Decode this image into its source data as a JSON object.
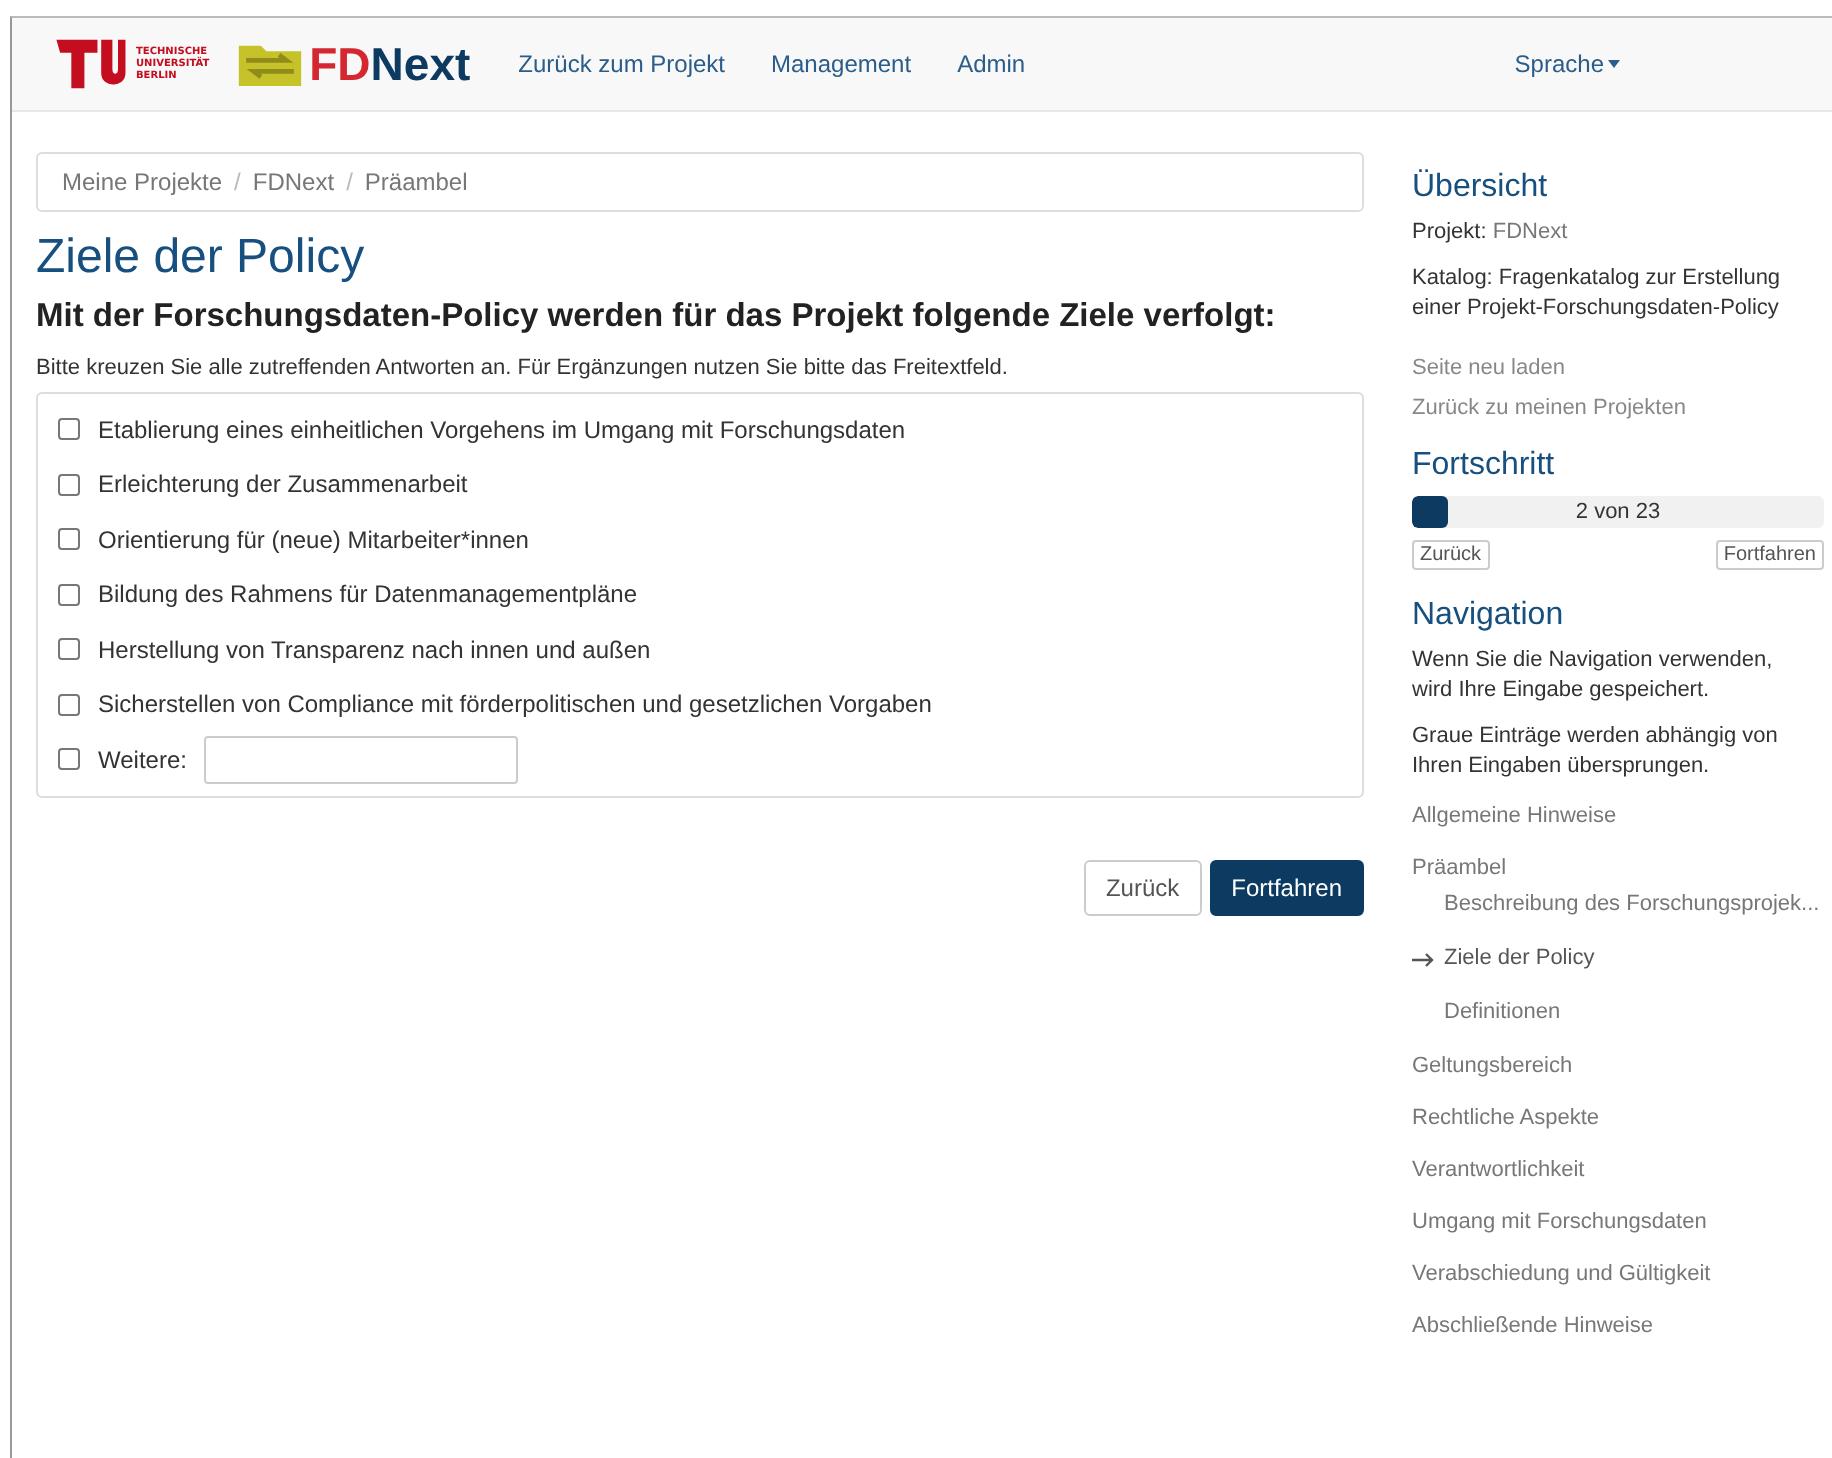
{
  "navbar": {
    "logo_lines": [
      "TECHNISCHE",
      "UNIVERSITÄT",
      "BERLIN"
    ],
    "brand": {
      "part1": "FD",
      "part2": "Next"
    },
    "links": [
      "Zurück zum Projekt",
      "Management",
      "Admin"
    ],
    "language": "Sprache"
  },
  "breadcrumb": {
    "separator": "/",
    "items": [
      "Meine Projekte",
      "FDNext",
      "Präambel"
    ]
  },
  "page_title": "Ziele der Policy",
  "question": "Mit der Forschungsdaten-Policy werden für das Projekt folgende Ziele verfolgt:",
  "help": "Bitte kreuzen Sie alle zutreffenden Antworten an. Für Ergänzungen nutzen Sie bitte das Freitextfeld.",
  "options": [
    {
      "label": "Etablierung eines einheitlichen Vorgehens im Umgang mit Forschungsdaten",
      "checked": false,
      "kind": "plain"
    },
    {
      "label": "Erleichterung der Zusammenarbeit",
      "checked": false,
      "kind": "plain"
    },
    {
      "label": "Orientierung für (neue) Mitarbeiter*innen",
      "checked": false,
      "kind": "plain"
    },
    {
      "label": "Bildung des Rahmens für Datenmanagementpläne",
      "checked": false,
      "kind": "plain"
    },
    {
      "label": "Herstellung von Transparenz nach innen und außen",
      "checked": false,
      "kind": "plain"
    },
    {
      "label": "Sicherstellen von Compliance mit förderpolitischen und gesetzlichen Vorgaben",
      "checked": false,
      "kind": "plain"
    },
    {
      "label": "Weitere:",
      "checked": false,
      "kind": "text"
    }
  ],
  "buttons": {
    "back": "Zurück",
    "next": "Fortfahren"
  },
  "sidebar": {
    "overview_title": "Übersicht",
    "project_label": "Projekt:",
    "project": "FDNext",
    "catalog": "Katalog: Fragenkatalog zur Erstellung einer Projekt-Forschungsdaten-Policy",
    "links": [
      "Seite neu laden",
      "Zurück zu meinen Projekten"
    ],
    "progress_title": "Fortschritt",
    "progress": {
      "level": 0.087,
      "reading": "2 von 23"
    },
    "progress_back": "Zurück",
    "progress_next": "Fortfahren",
    "navigation_title": "Navigation",
    "notes": [
      "Wenn Sie die Navigation verwenden, wird Ihre Eingabe gespeichert.",
      "Graue Einträge werden abhängig von Ihren Eingaben übersprungen."
    ],
    "sections": [
      {
        "label": "Allgemeine Hinweise",
        "current": false
      },
      {
        "label": "Präambel",
        "current": false,
        "children": [
          {
            "label": "Beschreibung des Forschungsprojek...",
            "current": false
          },
          {
            "label": "Ziele der Policy",
            "current": true
          },
          {
            "label": "Definitionen",
            "current": false
          }
        ]
      },
      {
        "label": "Geltungsbereich",
        "current": false
      },
      {
        "label": "Rechtliche Aspekte",
        "current": false
      },
      {
        "label": "Verantwortlichkeit",
        "current": false
      },
      {
        "label": "Umgang mit Forschungsdaten",
        "current": false
      },
      {
        "label": "Verabschiedung und Gültigkeit",
        "current": false
      },
      {
        "label": "Abschließende Hinweise",
        "current": false
      }
    ]
  }
}
